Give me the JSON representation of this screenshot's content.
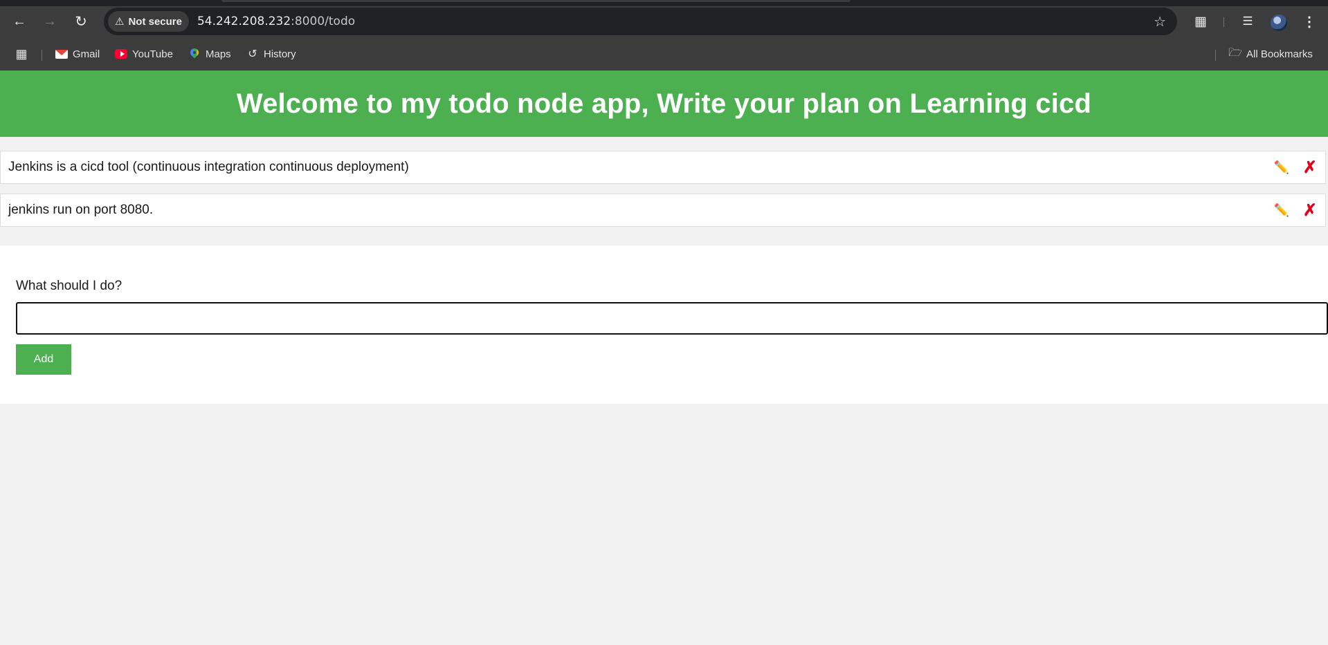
{
  "browser": {
    "security_chip": "Not secure",
    "url_host": "54.242.208.232",
    "url_path": ":8000/todo",
    "bookmarks": [
      {
        "label": "Gmail",
        "icon": "gmail-icon"
      },
      {
        "label": "YouTube",
        "icon": "youtube-icon"
      },
      {
        "label": "Maps",
        "icon": "maps-icon"
      },
      {
        "label": "History",
        "icon": "history-icon"
      }
    ],
    "all_bookmarks": "All Bookmarks"
  },
  "app": {
    "heading": "Welcome to my todo node app, Write your plan on Learning cicd",
    "todos": [
      {
        "text": "Jenkins is a cicd tool (continuous integration continuous deployment)",
        "edit_icon": "✏️",
        "delete_icon": "✗"
      },
      {
        "text": "jenkins run on port 8080.",
        "edit_icon": "✏️",
        "delete_icon": "✗"
      }
    ],
    "form": {
      "label": "What should I do?",
      "input_value": "",
      "add_button": "Add"
    }
  },
  "colors": {
    "accent_green": "#4caf50",
    "delete_red": "#e2001a",
    "edit_yellow": "#f5b800"
  }
}
